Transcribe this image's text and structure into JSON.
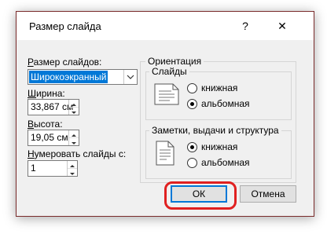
{
  "dialog": {
    "title": "Размер слайда",
    "help_label": "?",
    "close_label": "✕"
  },
  "left": {
    "size_label_underlined": "Р",
    "size_label_rest": "азмер слайдов:",
    "size_value": "Широкоэкранный",
    "width_label_underlined": "Ш",
    "width_label_rest": "ирина:",
    "width_value": "33,867 см",
    "height_label_underlined": "В",
    "height_label_rest": "ысота:",
    "height_value": "19,05 см",
    "number_label_underlined": "Н",
    "number_label_rest": "умеровать слайды с:",
    "number_value": "1"
  },
  "orientation": {
    "legend": "Ориентация",
    "slides": {
      "legend": "Слайды",
      "portrait_label": "книжная",
      "landscape_label": "альбомная",
      "selected": "landscape"
    },
    "notes": {
      "legend": "Заметки, выдачи и структура",
      "portrait_label": "книжная",
      "landscape_label": "альбомная",
      "selected": "portrait"
    }
  },
  "buttons": {
    "ok": "ОК",
    "cancel": "Отмена"
  },
  "colors": {
    "accent": "#0078d7",
    "highlight": "#e02020"
  }
}
